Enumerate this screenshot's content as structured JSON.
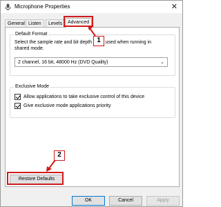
{
  "window": {
    "title": "Microphone Properties",
    "close_glyph": "✕"
  },
  "tabs": [
    {
      "label": "General"
    },
    {
      "label": "Listen"
    },
    {
      "label": "Levels"
    },
    {
      "label": "Advanced"
    }
  ],
  "default_format": {
    "group_label": "Default Format",
    "description": "Select the sample rate and bit depth to be used when running in shared mode.",
    "selected_value": "2 channel, 16 bit, 48000 Hz (DVD Quality)"
  },
  "exclusive_mode": {
    "group_label": "Exclusive Mode",
    "options": [
      {
        "label": "Allow applications to take exclusive control of this device",
        "checked": true
      },
      {
        "label": "Give exclusive mode applications priority",
        "checked": true
      }
    ]
  },
  "restore_defaults_label": "Restore Defaults",
  "footer": {
    "ok": "OK",
    "cancel": "Cancel",
    "apply": "Apply"
  },
  "annotations": [
    {
      "number": "1"
    },
    {
      "number": "2"
    }
  ],
  "colors": {
    "annotation_red": "#d01a1a",
    "focus_blue": "#0078d7"
  },
  "icons": {
    "title": "microphone-icon",
    "dropdown": "chevron-down-icon",
    "close": "close-icon"
  }
}
